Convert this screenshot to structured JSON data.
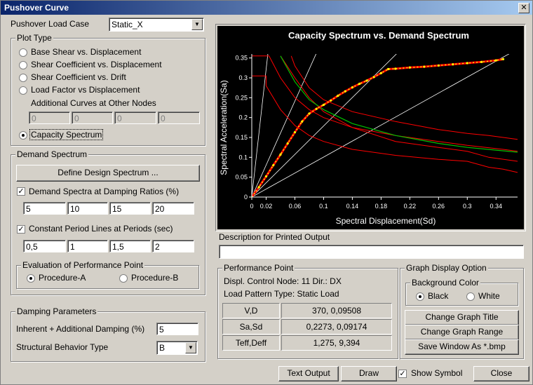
{
  "window": {
    "title": "Pushover Curve",
    "close_label": "✕"
  },
  "load_case": {
    "label": "Pushover Load Case",
    "value": "Static_X"
  },
  "plot_type": {
    "title": "Plot Type",
    "options": [
      "Base Shear vs. Displacement",
      "Shear Coefficient vs. Displacement",
      "Shear Coefficient vs. Drift",
      "Load Factor vs Displacement"
    ],
    "additional_label": "Additional Curves at Other Nodes",
    "node_values": [
      "0",
      "0",
      "0",
      "0"
    ],
    "capacity_label": "Capacity Spectrum",
    "selected": "Capacity Spectrum"
  },
  "demand": {
    "title": "Demand Spectrum",
    "define_button": "Define Design Spectrum ...",
    "damping_label": "Demand Spectra at Damping Ratios (%)",
    "damping_checked": true,
    "damping_values": [
      "5",
      "10",
      "15",
      "20"
    ],
    "period_label": "Constant Period Lines at Periods (sec)",
    "period_checked": true,
    "period_values": [
      "0,5",
      "1",
      "1,5",
      "2"
    ],
    "evaluation": {
      "title": "Evaluation of Performance Point",
      "proc_a": "Procedure-A",
      "proc_b": "Procedure-B",
      "selected": "Procedure-A"
    }
  },
  "damping": {
    "title": "Damping Parameters",
    "inherent_label": "Inherent + Additional Damping (%)",
    "inherent_value": "5",
    "behavior_label": "Structural Behavior Type",
    "behavior_value": "B"
  },
  "description": {
    "label": "Description for Printed Output",
    "value": ""
  },
  "performance": {
    "title": "Performance Point",
    "line1": "Displ. Control Node: 11  Dir.: DX",
    "line2": "Load Pattern Type: Static Load",
    "rows": [
      {
        "name": "V,D",
        "value": "370,  0,09508"
      },
      {
        "name": "Sa,Sd",
        "value": "0,2273,  0,09174"
      },
      {
        "name": "Teff,Deff",
        "value": "1,275,    9,394"
      }
    ]
  },
  "graph_option": {
    "title": "Graph Display Option",
    "bg_title": "Background Color",
    "black": "Black",
    "white": "White",
    "selected": "Black",
    "change_title": "Change Graph Title",
    "change_range": "Change Graph Range",
    "save": "Save Window As *.bmp"
  },
  "footer": {
    "text_output": "Text Output",
    "draw": "Draw",
    "show_symbol": "Show Symbol",
    "show_symbol_checked": true,
    "close": "Close"
  },
  "colors": {
    "chart_bg": "#000000",
    "capacity": "#ff0000",
    "capacity_symbol": "#ffff00",
    "demand": "#ff0000",
    "design_spectrum": "#00c000",
    "period_lines": "#ffffff",
    "title_bar": "#0a246a"
  },
  "chart_data": {
    "type": "line",
    "title": "Capacity Spectrum vs. Demand Spectrum",
    "xlabel": "Spectral Displacement(Sd)",
    "ylabel": "Spectral Acceleration(Sa)",
    "xlim": [
      0,
      0.37
    ],
    "ylim": [
      0,
      0.36
    ],
    "xticks": [
      "0",
      "0.02",
      "0.06",
      "0.1",
      "0.14",
      "0.18",
      "0.22",
      "0.26",
      "0.3",
      "0.34"
    ],
    "xtick_values": [
      0,
      0.02,
      0.06,
      0.1,
      0.14,
      0.18,
      0.22,
      0.26,
      0.3,
      0.34
    ],
    "yticks": [
      "0",
      "0.05",
      "0.1",
      "0.15",
      "0.2",
      "0.25",
      "0.3",
      "0.35"
    ],
    "ytick_values": [
      0,
      0.05,
      0.1,
      0.15,
      0.2,
      0.25,
      0.3,
      0.35
    ],
    "capacity": {
      "x": [
        0,
        0.01,
        0.02,
        0.03,
        0.04,
        0.05,
        0.06,
        0.07,
        0.08,
        0.09,
        0.1,
        0.11,
        0.12,
        0.13,
        0.14,
        0.15,
        0.16,
        0.17,
        0.18,
        0.19,
        0.2,
        0.22,
        0.24,
        0.26,
        0.28,
        0.3,
        0.32,
        0.34,
        0.35
      ],
      "y": [
        0,
        0.025,
        0.052,
        0.08,
        0.107,
        0.135,
        0.163,
        0.19,
        0.21,
        0.222,
        0.232,
        0.243,
        0.255,
        0.266,
        0.276,
        0.285,
        0.293,
        0.302,
        0.312,
        0.322,
        0.323,
        0.326,
        0.328,
        0.331,
        0.334,
        0.337,
        0.34,
        0.344,
        0.347
      ]
    },
    "demand_series": [
      {
        "plateau": 0.355,
        "x": [
          0,
          0.024,
          0.024,
          0.04,
          0.06,
          0.08,
          0.1,
          0.14,
          0.2,
          0.26,
          0.3,
          0.35,
          0.37
        ],
        "y": [
          0.355,
          0.355,
          0.355,
          0.3,
          0.25,
          0.22,
          0.2,
          0.175,
          0.155,
          0.14,
          0.13,
          0.12,
          0.115
        ]
      },
      {
        "plateau": 0.305,
        "x": [
          0,
          0.02,
          0.02,
          0.04,
          0.06,
          0.08,
          0.1,
          0.14,
          0.2,
          0.26,
          0.3,
          0.33,
          0.35,
          0.37
        ],
        "y": [
          0.305,
          0.305,
          0.28,
          0.22,
          0.18,
          0.155,
          0.14,
          0.12,
          0.105,
          0.095,
          0.09,
          0.075,
          0.07,
          0.062
        ]
      },
      {
        "x": [
          0.055,
          0.06,
          0.08,
          0.1,
          0.14,
          0.2,
          0.26,
          0.3,
          0.33,
          0.35,
          0.37
        ],
        "y": [
          0.355,
          0.33,
          0.275,
          0.245,
          0.215,
          0.19,
          0.17,
          0.16,
          0.155,
          0.15,
          0.145
        ]
      },
      {
        "x": [
          0.04,
          0.06,
          0.08,
          0.1,
          0.14,
          0.2,
          0.26,
          0.3,
          0.33,
          0.37
        ],
        "y": [
          0.355,
          0.3,
          0.25,
          0.215,
          0.175,
          0.14,
          0.125,
          0.115,
          0.1,
          0.09
        ]
      }
    ],
    "design_spectrum": {
      "x": [
        0.04,
        0.06,
        0.08,
        0.1,
        0.14,
        0.2,
        0.26,
        0.3,
        0.34,
        0.37
      ],
      "y": [
        0.355,
        0.29,
        0.245,
        0.22,
        0.185,
        0.155,
        0.135,
        0.125,
        0.118,
        0.113
      ]
    },
    "period_lines": {
      "periods": [
        0.5,
        1,
        1.5,
        2
      ]
    }
  }
}
